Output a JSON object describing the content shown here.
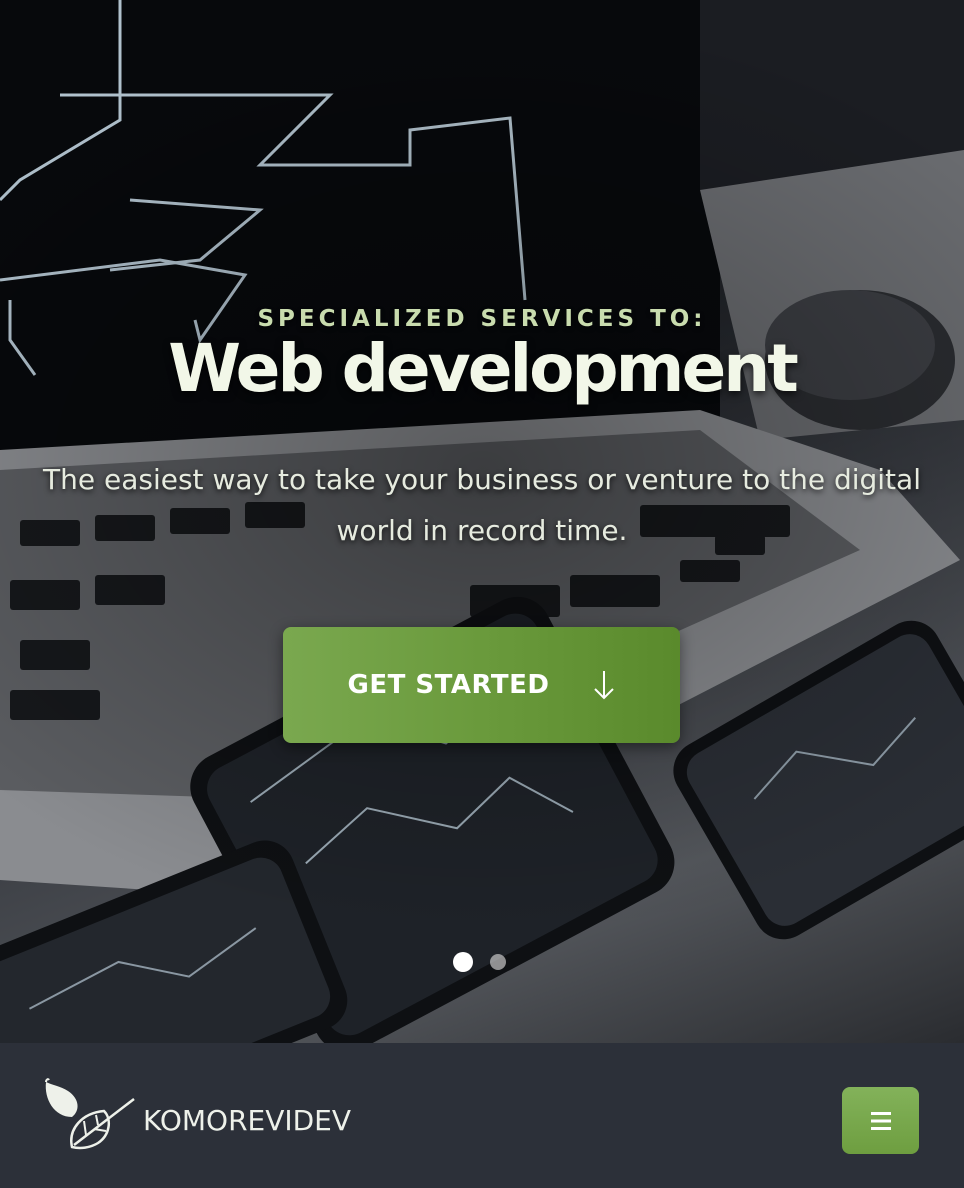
{
  "hero": {
    "kicker": "SPECIALIZED SERVICES TO:",
    "headline": "Web development",
    "subtitle": "The easiest way to take your business or venture to the digital world in record time.",
    "cta_label": "GET STARTED",
    "cta_icon": "arrow-down-icon",
    "slides": {
      "total": 2,
      "active": 1
    }
  },
  "footer": {
    "brand": "KOMOREVIDEV",
    "logo_icon": "leaves-icon",
    "menu_icon": "hamburger-menu-icon"
  },
  "colors": {
    "accent_green": "#6a9a3c",
    "kicker_green": "#c9dcae",
    "footer_bg": "#2c3039"
  }
}
